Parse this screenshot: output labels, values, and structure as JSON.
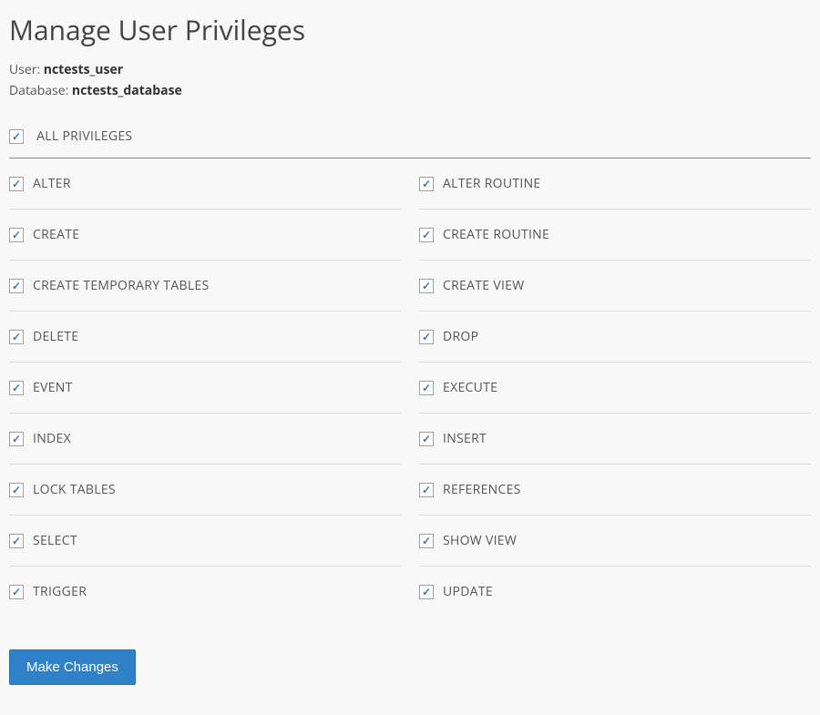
{
  "title": "Manage User Privileges",
  "user_label": "User: ",
  "user_value": "nctests_user",
  "database_label": "Database: ",
  "database_value": "nctests_database",
  "all_privileges": {
    "label": "ALL PRIVILEGES",
    "checked": true
  },
  "privileges": [
    {
      "label": "ALTER",
      "checked": true
    },
    {
      "label": "ALTER ROUTINE",
      "checked": true
    },
    {
      "label": "CREATE",
      "checked": true
    },
    {
      "label": "CREATE ROUTINE",
      "checked": true
    },
    {
      "label": "CREATE TEMPORARY TABLES",
      "checked": true
    },
    {
      "label": "CREATE VIEW",
      "checked": true
    },
    {
      "label": "DELETE",
      "checked": true
    },
    {
      "label": "DROP",
      "checked": true
    },
    {
      "label": "EVENT",
      "checked": true
    },
    {
      "label": "EXECUTE",
      "checked": true
    },
    {
      "label": "INDEX",
      "checked": true
    },
    {
      "label": "INSERT",
      "checked": true
    },
    {
      "label": "LOCK TABLES",
      "checked": true
    },
    {
      "label": "REFERENCES",
      "checked": true
    },
    {
      "label": "SELECT",
      "checked": true
    },
    {
      "label": "SHOW VIEW",
      "checked": true
    },
    {
      "label": "TRIGGER",
      "checked": true
    },
    {
      "label": "UPDATE",
      "checked": true
    }
  ],
  "submit_label": "Make Changes"
}
